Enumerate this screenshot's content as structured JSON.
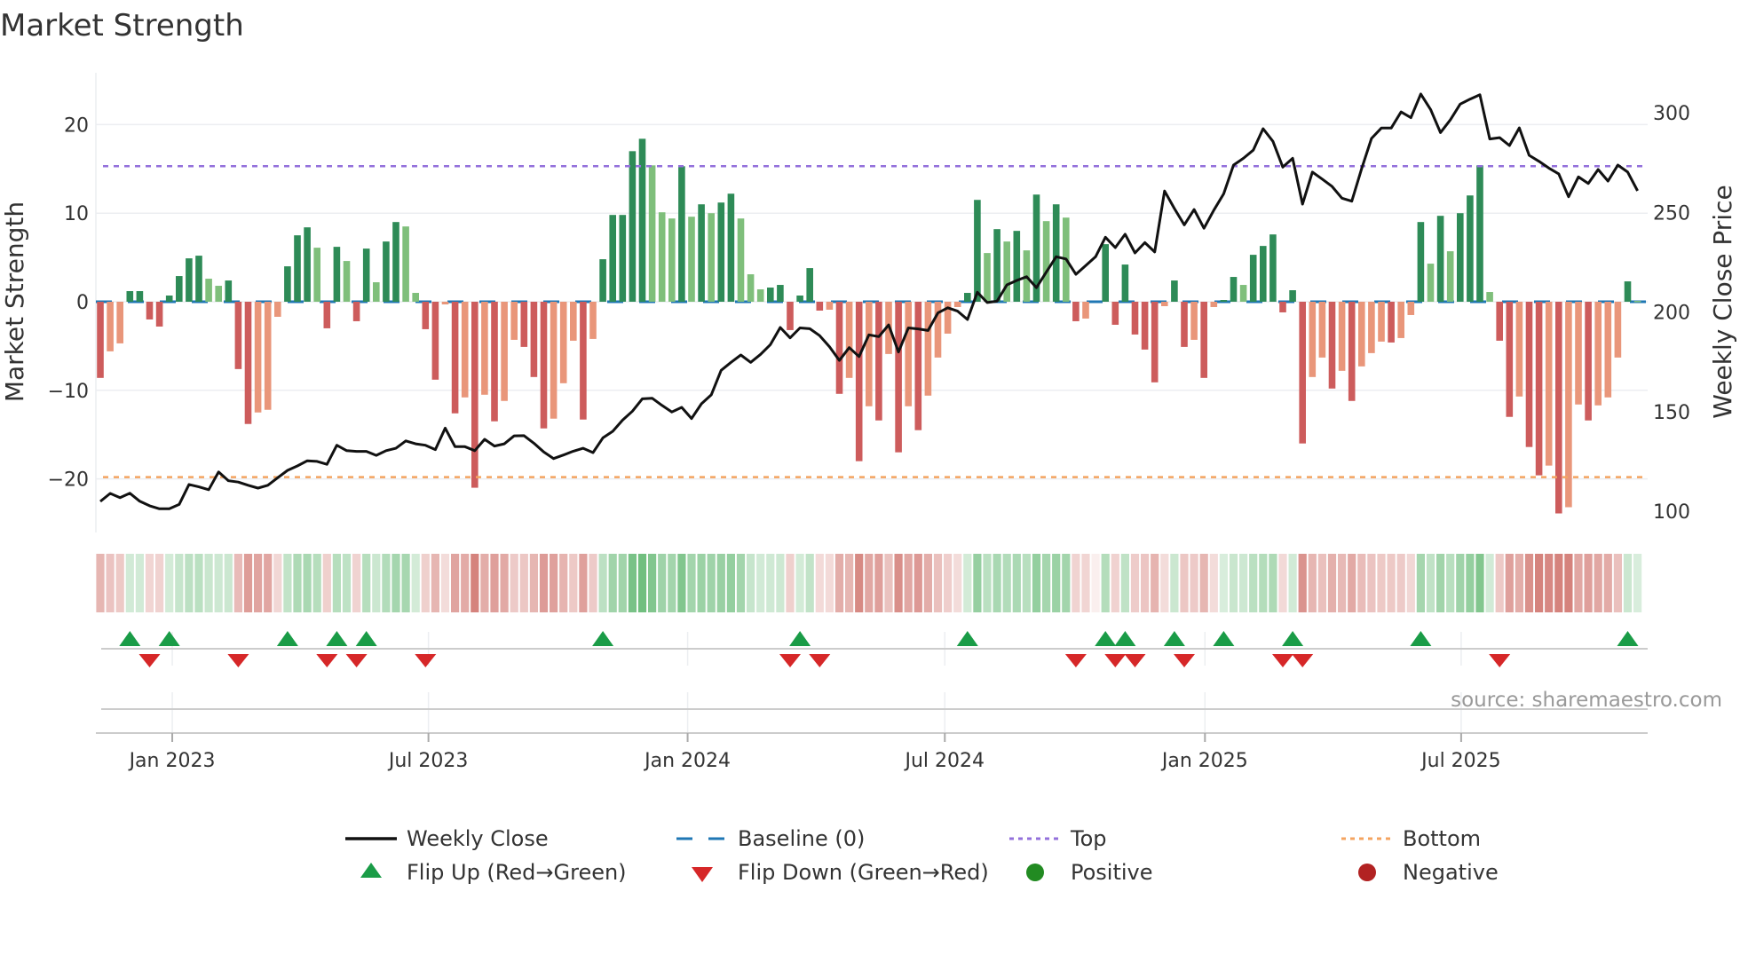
{
  "title": "Market Strength",
  "source": "source: sharemaestro.com",
  "colors": {
    "bar_up_strong": "#2e8b57",
    "bar_up_weak": "#7fbf7b",
    "bar_down_strong": "#cd5c5c",
    "bar_down_weak": "#e9967a",
    "close": "#111111",
    "baseline": "#1f77b4",
    "top": "#9370db",
    "bottom": "#f4a460",
    "flip_up": "#1a9c47",
    "flip_down": "#d62728",
    "positive": "#228b22",
    "negative": "#b22222"
  },
  "chart_data": {
    "type": "bar+line",
    "title": "Market Strength",
    "ylabel": "Market Strength",
    "y2label": "Weekly Close Price",
    "ylim": [
      -26,
      26
    ],
    "y2lim": [
      90,
      320
    ],
    "yticks": [
      -20,
      -10,
      0,
      10,
      20
    ],
    "yticklabels": [
      "−20",
      "−10",
      "0",
      "10",
      "20"
    ],
    "y2ticks": [
      100,
      150,
      200,
      250,
      300
    ],
    "y2ticklabels": [
      "100",
      "150",
      "200",
      "250",
      "300"
    ],
    "xticks_week_index": [
      7.3,
      33.3,
      59.6,
      85.7,
      112.1,
      138.1
    ],
    "xticklabels": [
      "Jan 2023",
      "Jul 2023",
      "Jan 2024",
      "Jul 2024",
      "Jan 2025",
      "Jul 2025"
    ],
    "top_level": 15.3,
    "bottom_level": -19.8,
    "baseline": 0,
    "strength": [
      -8.6,
      -5.6,
      -4.7,
      1.2,
      1.2,
      -2.0,
      -2.8,
      0.7,
      2.9,
      4.9,
      5.2,
      2.6,
      1.8,
      2.4,
      -7.6,
      -13.8,
      -12.5,
      -12.2,
      -1.7,
      4.0,
      7.5,
      8.4,
      6.1,
      -3.0,
      6.2,
      4.6,
      -2.2,
      6.0,
      2.2,
      6.8,
      9.0,
      8.5,
      1.0,
      -3.1,
      -8.8,
      -0.3,
      -12.6,
      -10.8,
      -21.0,
      -10.5,
      -13.5,
      -11.2,
      -4.3,
      -5.1,
      -8.5,
      -14.3,
      -13.2,
      -9.2,
      -4.4,
      -13.3,
      -4.2,
      4.8,
      9.8,
      9.8,
      17.0,
      18.4,
      15.4,
      10.1,
      9.4,
      15.3,
      9.6,
      11.0,
      10.0,
      11.2,
      12.2,
      9.4,
      3.1,
      1.4,
      1.6,
      1.9,
      -3.2,
      0.7,
      3.8,
      -1.0,
      -0.9,
      -10.4,
      -8.6,
      -18.0,
      -11.8,
      -13.4,
      -5.9,
      -17.0,
      -11.8,
      -14.5,
      -10.6,
      -6.3,
      -3.6,
      -0.6,
      1.0,
      11.5,
      5.5,
      8.2,
      6.8,
      8.0,
      5.8,
      12.1,
      9.1,
      11.0,
      9.5,
      -2.2,
      -1.9,
      0,
      6.5,
      -2.6,
      4.2,
      -3.7,
      -5.4,
      -9.1,
      -0.5,
      2.4,
      -5.1,
      -4.3,
      -8.6,
      -0.6,
      0.2,
      2.8,
      1.9,
      5.3,
      6.3,
      7.6,
      -1.2,
      1.3,
      -16.0,
      -8.5,
      -6.3,
      -9.8,
      -7.8,
      -11.2,
      -7.3,
      -5.8,
      -4.5,
      -4.6,
      -4.1,
      -1.5,
      9.0,
      4.3,
      9.7,
      5.7,
      10.0,
      12.0,
      15.4,
      1.1,
      -4.4,
      -13.0,
      -10.7,
      -16.4,
      -19.6,
      -18.5,
      -23.9,
      -23.2,
      -11.6,
      -13.4,
      -11.7,
      -10.8,
      -6.3,
      2.3,
      0.1
    ],
    "close": [
      104.9,
      108.9,
      106.8,
      109.0,
      105.0,
      102.7,
      101.2,
      101.2,
      103.4,
      113.4,
      112.2,
      110.8,
      119.7,
      115.3,
      114.6,
      113.0,
      111.6,
      113.0,
      116.8,
      120.5,
      122.7,
      125.3,
      125.0,
      123.5,
      133.1,
      130.4,
      130.0,
      130.0,
      128.0,
      130.4,
      131.6,
      135.3,
      133.8,
      133.1,
      130.9,
      141.7,
      132.4,
      132.4,
      130.4,
      136.1,
      132.7,
      133.8,
      137.8,
      137.9,
      134.1,
      129.7,
      126.4,
      128.2,
      130.1,
      131.6,
      129.4,
      136.8,
      140.1,
      145.7,
      150.2,
      156.4,
      156.7,
      153.1,
      149.8,
      152.1,
      146.5,
      153.9,
      158.4,
      170.7,
      174.7,
      178.4,
      174.7,
      178.7,
      183.6,
      192.2,
      187.0,
      192.0,
      191.6,
      188.1,
      182.5,
      175.7,
      182.1,
      177.6,
      188.5,
      187.6,
      193.5,
      179.9,
      192.0,
      191.5,
      190.7,
      199.5,
      202.1,
      200.4,
      196.2,
      209.9,
      204.7,
      205.4,
      213.6,
      215.8,
      217.7,
      212.2,
      220.0,
      227.7,
      226.6,
      218.9,
      223.3,
      227.7,
      237.5,
      232.3,
      239.0,
      229.6,
      234.8,
      230.1,
      260.7,
      251.9,
      243.7,
      251.4,
      242.0,
      251.1,
      259.3,
      273.7,
      277.1,
      281.2,
      292.0,
      285.6,
      272.7,
      277.1,
      254.1,
      270.2,
      266.7,
      263.0,
      257.1,
      255.6,
      271.9,
      287.1,
      292.3,
      292.3,
      300.4,
      297.5,
      309.4,
      301.6,
      290.0,
      296.4,
      304.3,
      306.8,
      309.0,
      286.8,
      287.5,
      283.5,
      292.4,
      278.6,
      275.6,
      272.2,
      269.3,
      257.8,
      267.8,
      264.5,
      271.5,
      265.7,
      273.7,
      270.2,
      260.8
    ],
    "legend": {
      "position": "bottom",
      "items": [
        {
          "label": "Weekly Close",
          "kind": "line"
        },
        {
          "label": "Baseline (0)",
          "kind": "dash"
        },
        {
          "label": "Top",
          "kind": "dot-top"
        },
        {
          "label": "Bottom",
          "kind": "dot-bottom"
        },
        {
          "label": "Flip Up (Red→Green)",
          "kind": "tri-up"
        },
        {
          "label": "Flip Down (Green→Red)",
          "kind": "tri-down"
        },
        {
          "label": "Positive",
          "kind": "circle-pos"
        },
        {
          "label": "Negative",
          "kind": "circle-neg"
        }
      ]
    }
  }
}
